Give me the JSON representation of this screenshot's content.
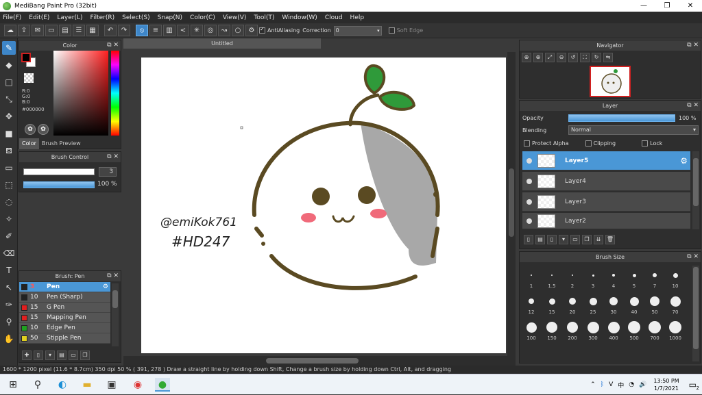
{
  "window": {
    "title": "MediBang Paint Pro (32bit)",
    "minimize": "—",
    "restore": "❐",
    "close": "✕"
  },
  "menu": [
    "File(F)",
    "Edit(E)",
    "Layer(L)",
    "Filter(R)",
    "Select(S)",
    "Snap(N)",
    "Color(C)",
    "View(V)",
    "Tool(T)",
    "Window(W)",
    "Cloud",
    "Help"
  ],
  "toolbar": {
    "antialias_label": "AntiAliasing",
    "correction_label": "Correction",
    "correction_value": "0",
    "soft_edge_label": "Soft Edge"
  },
  "color_panel": {
    "title": "Color",
    "r": "R:0",
    "g": "G:0",
    "b": "B:0",
    "hex": "#000000",
    "tab_color": "Color",
    "tab_preview": "Brush Preview"
  },
  "brush_control": {
    "title": "Brush Control",
    "size": "3",
    "opacity": "100 %"
  },
  "brush_list": {
    "title": "Brush: Pen",
    "items": [
      {
        "num": "3",
        "name": "Pen",
        "color": "#222222"
      },
      {
        "num": "10",
        "name": "Pen (Sharp)",
        "color": "#222222"
      },
      {
        "num": "15",
        "name": "G Pen",
        "color": "#e02020"
      },
      {
        "num": "15",
        "name": "Mapping Pen",
        "color": "#e02020"
      },
      {
        "num": "10",
        "name": "Edge Pen",
        "color": "#20a020"
      },
      {
        "num": "50",
        "name": "Stipple Pen",
        "color": "#e0d020"
      }
    ]
  },
  "document": {
    "tab": "Untitled",
    "handwriting_line1": "@emiKok761",
    "handwriting_line2": "#HD247"
  },
  "navigator": {
    "title": "Navigator"
  },
  "layer_panel": {
    "title": "Layer",
    "opacity_label": "Opacity",
    "opacity_value": "100 %",
    "blending_label": "Blending",
    "blending_value": "Normal",
    "protect_alpha": "Protect Alpha",
    "clipping": "Clipping",
    "lock": "Lock",
    "layers": [
      "Layer5",
      "Layer4",
      "Layer3",
      "Layer2"
    ]
  },
  "brush_size": {
    "title": "Brush Size",
    "sizes": [
      "1",
      "1.5",
      "2",
      "3",
      "4",
      "5",
      "7",
      "10",
      "12",
      "15",
      "20",
      "25",
      "30",
      "40",
      "50",
      "70",
      "100",
      "150",
      "200",
      "300",
      "400",
      "500",
      "700",
      "1000"
    ]
  },
  "status": "1600 * 1200 pixel   (11.6 * 8.7cm)   350 dpi   50 %   ( 391, 278 )   Draw a straight line by holding down Shift, Change a brush size by holding down Ctrl, Alt, and dragging",
  "taskbar": {
    "time": "13:50 PM",
    "date": "1/7/2021",
    "notifications": "2"
  },
  "colors": {
    "accent": "#4a97d6",
    "panel": "#2e2e2e",
    "outline": "#5a4a22",
    "leaf": "#2f9a3a"
  }
}
